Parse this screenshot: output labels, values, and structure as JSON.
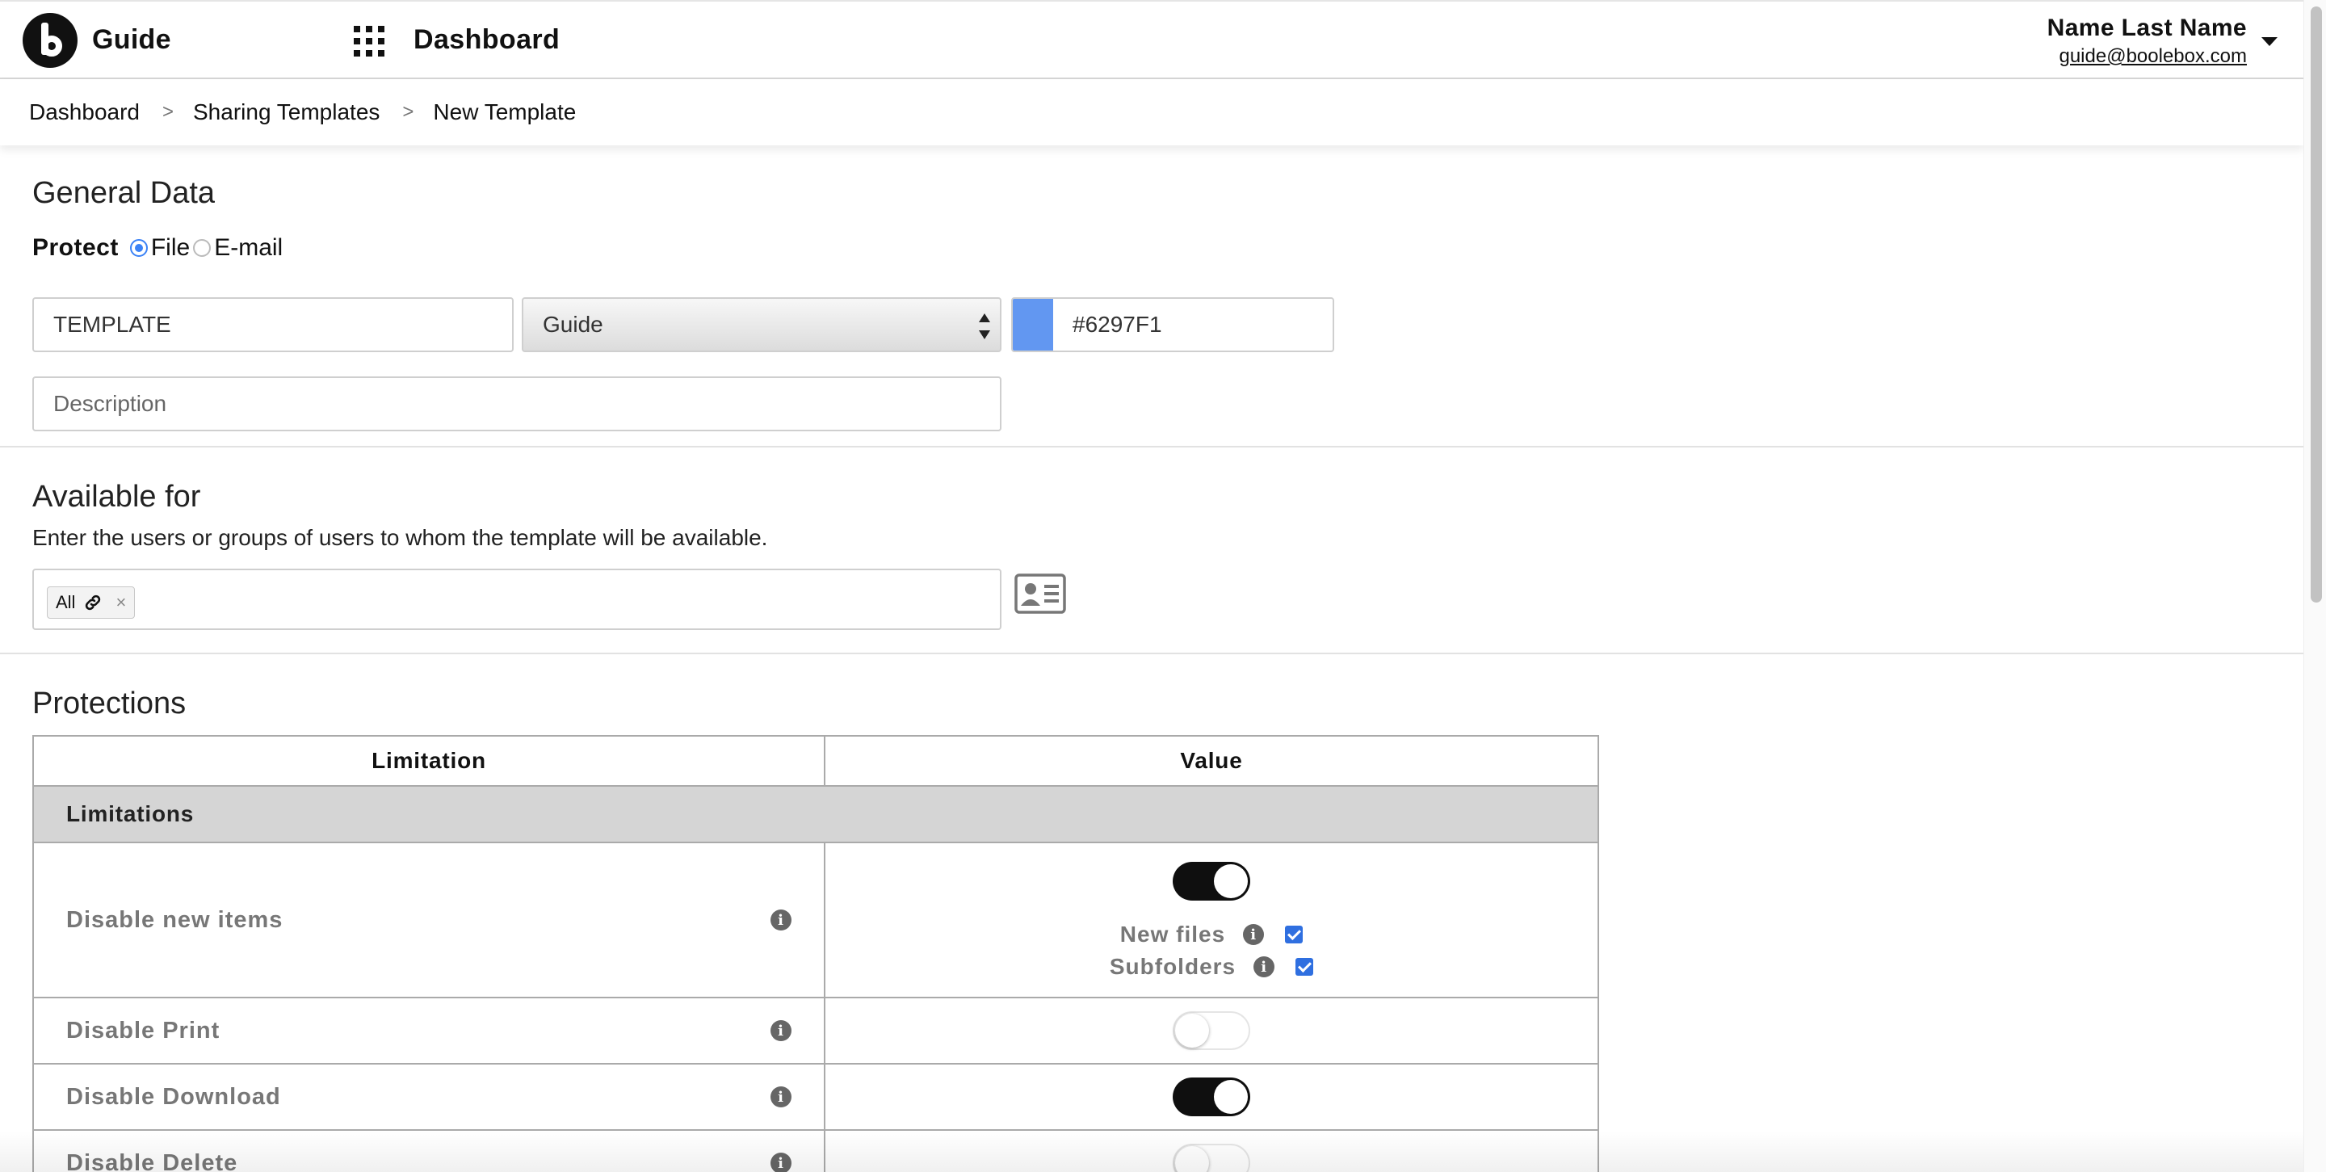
{
  "header": {
    "app_name": "Guide",
    "title": "Dashboard",
    "user_name": "Name Last Name",
    "user_email": "guide@boolebox.com"
  },
  "breadcrumb": [
    "Dashboard",
    "Sharing Templates",
    "New Template"
  ],
  "general": {
    "title": "General Data",
    "protect_label": "Protect",
    "protect_options": [
      "File",
      "E-mail"
    ],
    "protect_selected": "File",
    "name_value": "TEMPLATE",
    "select_value": "Guide",
    "color_value": "#6297F1",
    "description_placeholder": "Description"
  },
  "available": {
    "title": "Available for",
    "description": "Enter the users or groups of users to whom the template will be available.",
    "tags": [
      "All"
    ]
  },
  "protections": {
    "title": "Protections",
    "columns": [
      "Limitation",
      "Value"
    ],
    "group": "Limitations",
    "rows": [
      {
        "label": "Disable new items",
        "enabled": true,
        "sub_options": [
          {
            "label": "New files",
            "checked": true
          },
          {
            "label": "Subfolders",
            "checked": true
          }
        ]
      },
      {
        "label": "Disable Print",
        "enabled": false
      },
      {
        "label": "Disable Download",
        "enabled": true
      },
      {
        "label": "Disable Delete",
        "enabled": false
      }
    ]
  },
  "icons": {
    "logo": "boolebox-logo",
    "apps": "apps-grid-icon",
    "user_menu": "caret-down-icon",
    "info": "info-icon",
    "link": "link-icon",
    "contacts": "contact-card-icon"
  },
  "colors": {
    "accent": "#3b82f6",
    "checkbox": "#2f6fe0",
    "toggle_on": "#0f0f0f",
    "group_bg": "#d5d5d5"
  }
}
